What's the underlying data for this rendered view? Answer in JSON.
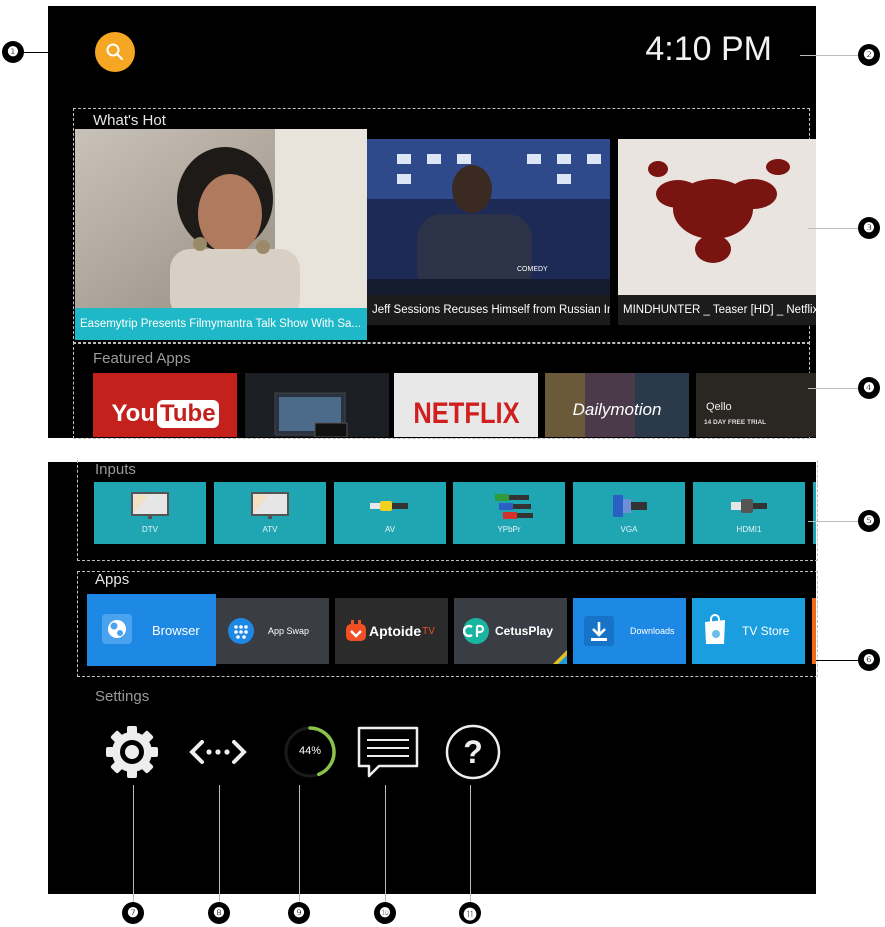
{
  "header": {
    "time": "4:10 PM"
  },
  "whats_hot": {
    "title": "What's Hot",
    "cards": [
      {
        "caption": "Easemytrip Presents Filmymantra Talk Show With Sa..."
      },
      {
        "caption": "Jeff Sessions Recuses Himself from Russian Investi..."
      },
      {
        "caption": "MINDHUNTER _ Teaser [HD] _ Netflix"
      }
    ]
  },
  "featured_apps": {
    "title": "Featured Apps",
    "tiles": [
      {
        "text_a": "You",
        "text_b": "Tube"
      },
      {
        "text": ""
      },
      {
        "text": "NETFLIX"
      },
      {
        "text": "Dailymotion"
      },
      {
        "text": "Qello",
        "sub": "14 DAY FREE TRIAL"
      }
    ]
  },
  "inputs": {
    "title": "Inputs",
    "items": [
      {
        "label": "DTV"
      },
      {
        "label": "ATV"
      },
      {
        "label": "AV"
      },
      {
        "label": "YPbPr"
      },
      {
        "label": "VGA"
      },
      {
        "label": "HDMI1"
      }
    ]
  },
  "apps": {
    "title": "Apps",
    "items": [
      {
        "label": "Browser"
      },
      {
        "label": "App Swap"
      },
      {
        "label_a": "Aptoide",
        "label_b": "TV"
      },
      {
        "label": "CetusPlay"
      },
      {
        "label": "Downloads"
      },
      {
        "label": "TV Store"
      }
    ]
  },
  "settings": {
    "title": "Settings",
    "storage_percent_label": "44%",
    "storage_fraction": 0.44
  },
  "callouts": [
    "❶",
    "❷",
    "❸",
    "❹",
    "❺",
    "❻",
    "❼",
    "❽",
    "❾",
    "❿",
    "⓫"
  ],
  "colors": {
    "accent_search": "#f5a623",
    "input_tile": "#20a6b3",
    "browser_tile": "#1e88e5",
    "tvstore_tile": "#1a9ee0",
    "panel_bg": "#000000"
  }
}
